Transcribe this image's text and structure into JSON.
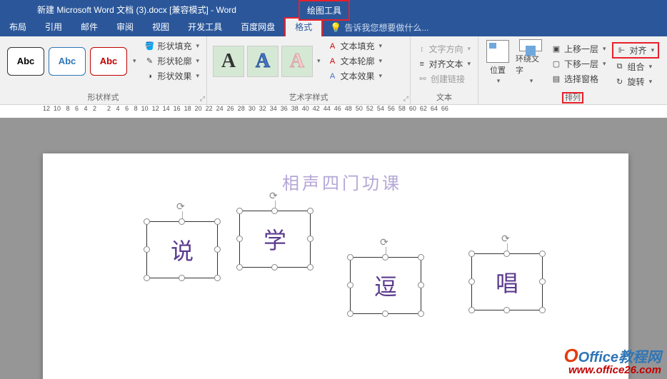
{
  "title": "新建 Microsoft Word 文档 (3).docx [兼容模式] - Word",
  "context_tab": "绘图工具",
  "tabs": {
    "layout": "布局",
    "references": "引用",
    "mail": "邮件",
    "review": "审阅",
    "view": "视图",
    "developer": "开发工具",
    "baidu": "百度网盘",
    "format": "格式",
    "tell_me": "告诉我您想要做什么..."
  },
  "ribbon": {
    "shape_styles": {
      "label": "形状样式",
      "sample": "Abc",
      "fill": "形状填充",
      "outline": "形状轮廓",
      "effects": "形状效果"
    },
    "wordart": {
      "label": "艺术字样式",
      "sample": "A",
      "text_fill": "文本填充",
      "text_outline": "文本轮廓",
      "text_effects": "文本效果"
    },
    "text": {
      "label": "文本",
      "direction": "文字方向",
      "align_text": "对齐文本",
      "create_link": "创建链接"
    },
    "arrange": {
      "label": "排列",
      "position": "位置",
      "wrap": "环绕文字",
      "bring_forward": "上移一层",
      "send_backward": "下移一层",
      "selection_pane": "选择窗格",
      "align": "对齐",
      "group": "组合",
      "rotate": "旋转"
    }
  },
  "ruler_start": 12,
  "document": {
    "title": "相声四门功课",
    "shapes": [
      "说",
      "学",
      "逗",
      "唱"
    ]
  },
  "watermark": {
    "brand": "Office教程网",
    "url": "www.office26.com"
  }
}
